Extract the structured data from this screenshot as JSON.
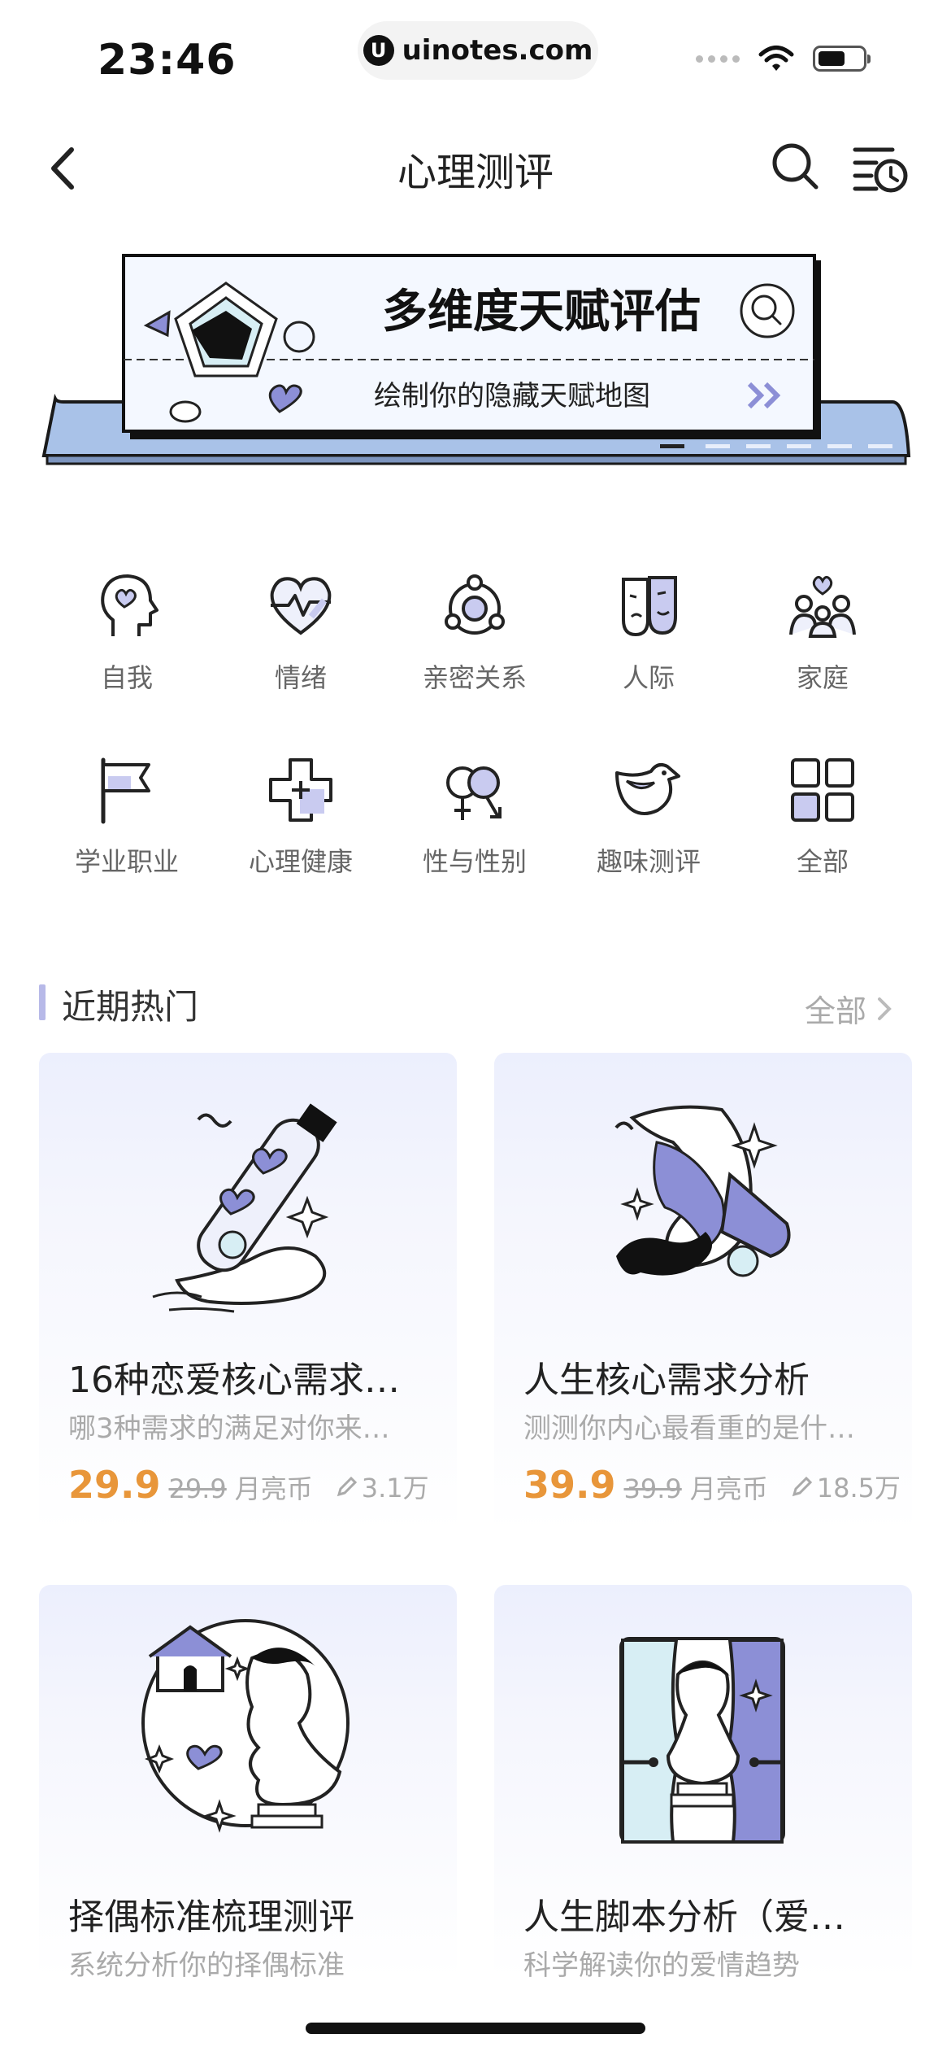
{
  "status": {
    "time": "23:46",
    "url": "uinotes.com"
  },
  "nav": {
    "title": "心理测评"
  },
  "banner": {
    "title": "多维度天赋评估",
    "subtitle": "绘制你的隐藏天赋地图"
  },
  "categories": [
    {
      "label": "自我",
      "icon": "head-heart-icon"
    },
    {
      "label": "情绪",
      "icon": "heart-pulse-icon"
    },
    {
      "label": "亲密关系",
      "icon": "orbit-icon"
    },
    {
      "label": "人际",
      "icon": "masks-icon"
    },
    {
      "label": "家庭",
      "icon": "family-icon"
    },
    {
      "label": "学业职业",
      "icon": "flag-icon"
    },
    {
      "label": "心理健康",
      "icon": "medical-cross-icon"
    },
    {
      "label": "性与性别",
      "icon": "gender-icon"
    },
    {
      "label": "趣味测评",
      "icon": "duck-icon"
    },
    {
      "label": "全部",
      "icon": "grid-icon"
    }
  ],
  "section": {
    "title": "近期热门",
    "more": "全部"
  },
  "cards": [
    {
      "title": "16种恋爱核心需求…",
      "desc": "哪3种需求的满足对你来…",
      "price": "29.9",
      "original": "29.9",
      "unit": "月亮币",
      "count": "3.1万"
    },
    {
      "title": "人生核心需求分析",
      "desc": "测测你内心最看重的是什…",
      "price": "39.9",
      "original": "39.9",
      "unit": "月亮币",
      "count": "18.5万"
    },
    {
      "title": "择偶标准梳理测评",
      "desc": "系统分析你的择偶标准"
    },
    {
      "title": "人生脚本分析（爱…",
      "desc": "科学解读你的爱情趋势"
    }
  ],
  "colors": {
    "accent": "#e8963a",
    "lavender": "#8c8fd6",
    "light_blue": "#dcefff"
  }
}
